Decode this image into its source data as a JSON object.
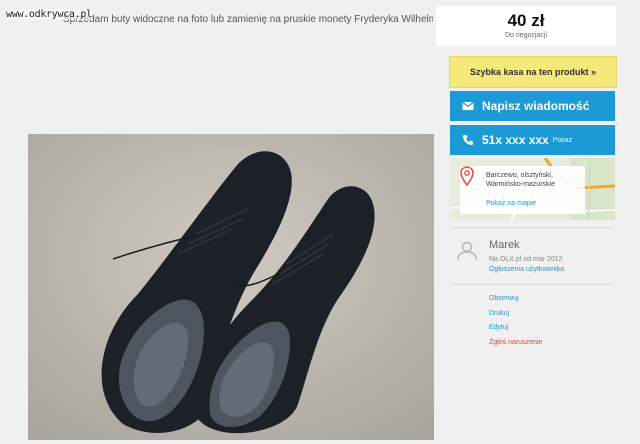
{
  "watermark": "www.odkrywca.pl",
  "description": "Sprzedam buty widoczne na foto lub zamienię na pruskie monety Fryderyka Wilhelma",
  "price": {
    "amount": "40 zł",
    "note": "Do negocjacji"
  },
  "buttons": {
    "fast_checkout": "Szybka kasa na ten produkt »",
    "message": "Napisz wiadomość",
    "phone_number": "51x xxx xxx",
    "phone_show": "Pokaż"
  },
  "location": {
    "lines": [
      "Barczewo, olsztyński,",
      "Warmińsko-mazurskie"
    ],
    "map_link": "Pokaż na mapie"
  },
  "seller": {
    "name": "Marek",
    "since": "Na OLX.pl od mar 2012",
    "ads_link": "Ogłoszenia użytkownika"
  },
  "actions": {
    "observe": "Obserwuj",
    "print": "Drukuj",
    "edit": "Edytuj",
    "report": "Zgłoś naruszenie"
  },
  "colors": {
    "accent_blue": "#1b9ad6",
    "highlight_yellow": "#f5e97a",
    "report_red": "#d64a3b"
  },
  "icons": [
    "envelope-icon",
    "phone-icon",
    "map-pin-icon",
    "user-icon"
  ]
}
